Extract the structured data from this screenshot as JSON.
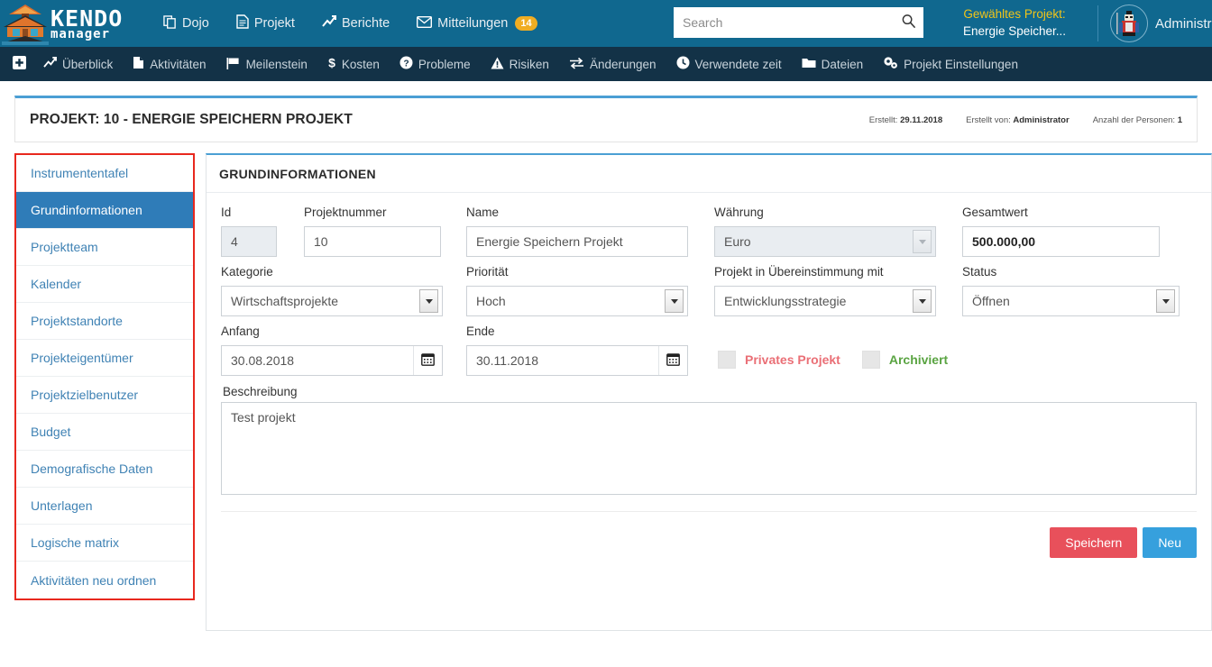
{
  "brand": {
    "name_line1": "KENDO",
    "name_line2": "manager",
    "logo_icon": "pagoda-logo-icon"
  },
  "header": {
    "nav": [
      {
        "label": "Dojo",
        "icon": "copy-icon"
      },
      {
        "label": "Projekt",
        "icon": "file-text-icon"
      },
      {
        "label": "Berichte",
        "icon": "chart-line-icon"
      },
      {
        "label": "Mitteilungen",
        "icon": "envelope-icon",
        "badge": "14"
      }
    ],
    "search": {
      "placeholder": "Search",
      "value": "",
      "icon": "search-icon"
    },
    "selected_project": {
      "label": "Gewähltes Projekt:",
      "value": "Energie Speicher..."
    },
    "user": {
      "name": "Administrat",
      "avatar_icon": "samurai-avatar-icon"
    }
  },
  "subnav": {
    "add_icon": "plus-square-icon",
    "items": [
      {
        "label": "Überblick",
        "icon": "chart-line-icon"
      },
      {
        "label": "Aktivitäten",
        "icon": "file-add-icon"
      },
      {
        "label": "Meilenstein",
        "icon": "flag-icon"
      },
      {
        "label": "Kosten",
        "icon": "dollar-icon"
      },
      {
        "label": "Probleme",
        "icon": "question-circle-icon"
      },
      {
        "label": "Risiken",
        "icon": "warning-triangle-icon"
      },
      {
        "label": "Änderungen",
        "icon": "exchange-arrows-icon"
      },
      {
        "label": "Verwendete zeit",
        "icon": "clock-icon"
      },
      {
        "label": "Dateien",
        "icon": "folder-icon"
      },
      {
        "label": "Projekt Einstellungen",
        "icon": "gears-icon"
      }
    ]
  },
  "project_header": {
    "title": "PROJEKT: 10 - ENERGIE SPEICHERN PROJEKT",
    "meta": [
      {
        "label": "Erstellt:",
        "value": "29.11.2018"
      },
      {
        "label": "Erstellt von:",
        "value": "Administrator"
      },
      {
        "label": "Anzahl der Personen:",
        "value": "1"
      }
    ]
  },
  "sidebar": {
    "items": [
      {
        "label": "Instrumententafel",
        "active": false
      },
      {
        "label": "Grundinformationen",
        "active": true
      },
      {
        "label": "Projektteam",
        "active": false
      },
      {
        "label": "Kalender",
        "active": false
      },
      {
        "label": "Projektstandorte",
        "active": false
      },
      {
        "label": "Projekteigentümer",
        "active": false
      },
      {
        "label": "Projektzielbenutzer",
        "active": false
      },
      {
        "label": "Budget",
        "active": false
      },
      {
        "label": "Demografische Daten",
        "active": false
      },
      {
        "label": "Unterlagen",
        "active": false
      },
      {
        "label": "Logische matrix",
        "active": false
      },
      {
        "label": "Aktivitäten neu ordnen",
        "active": false
      }
    ]
  },
  "panel": {
    "heading": "GRUNDINFORMATIONEN"
  },
  "form": {
    "id": {
      "label": "Id",
      "value": "4"
    },
    "projektnummer": {
      "label": "Projektnummer",
      "value": "10"
    },
    "name": {
      "label": "Name",
      "value": "Energie Speichern Projekt"
    },
    "waehrung": {
      "label": "Währung",
      "value": "Euro"
    },
    "gesamtwert": {
      "label": "Gesamtwert",
      "value": "500.000,00"
    },
    "kategorie": {
      "label": "Kategorie",
      "value": "Wirtschaftsprojekte"
    },
    "prioritaet": {
      "label": "Priorität",
      "value": "Hoch"
    },
    "uebereinstimmung": {
      "label": "Projekt in Übereinstimmung mit",
      "value": "Entwicklungsstrategie"
    },
    "status": {
      "label": "Status",
      "value": "Öffnen"
    },
    "anfang": {
      "label": "Anfang",
      "value": "30.08.2018",
      "icon": "calendar-icon"
    },
    "ende": {
      "label": "Ende",
      "value": "30.11.2018",
      "icon": "calendar-icon"
    },
    "privates_projekt": {
      "label": "Privates Projekt",
      "checked": false,
      "color": "#ea6f76"
    },
    "archiviert": {
      "label": "Archiviert",
      "checked": false,
      "color": "#5aa442"
    },
    "beschreibung": {
      "label": "Beschreibung",
      "value": "Test projekt"
    }
  },
  "footer": {
    "save_label": "Speichern",
    "new_label": "Neu"
  },
  "colors": {
    "header_blue": "#10688f",
    "subnav_dark": "#133247",
    "accent_blue": "#4b9fd4",
    "active_item": "#2f7cb8",
    "sidebar_border": "#e8281e",
    "badge_yellow": "#f0ad22",
    "save_red": "#e8505b",
    "new_blue": "#36a0dd",
    "link_blue": "#3f82b4"
  }
}
